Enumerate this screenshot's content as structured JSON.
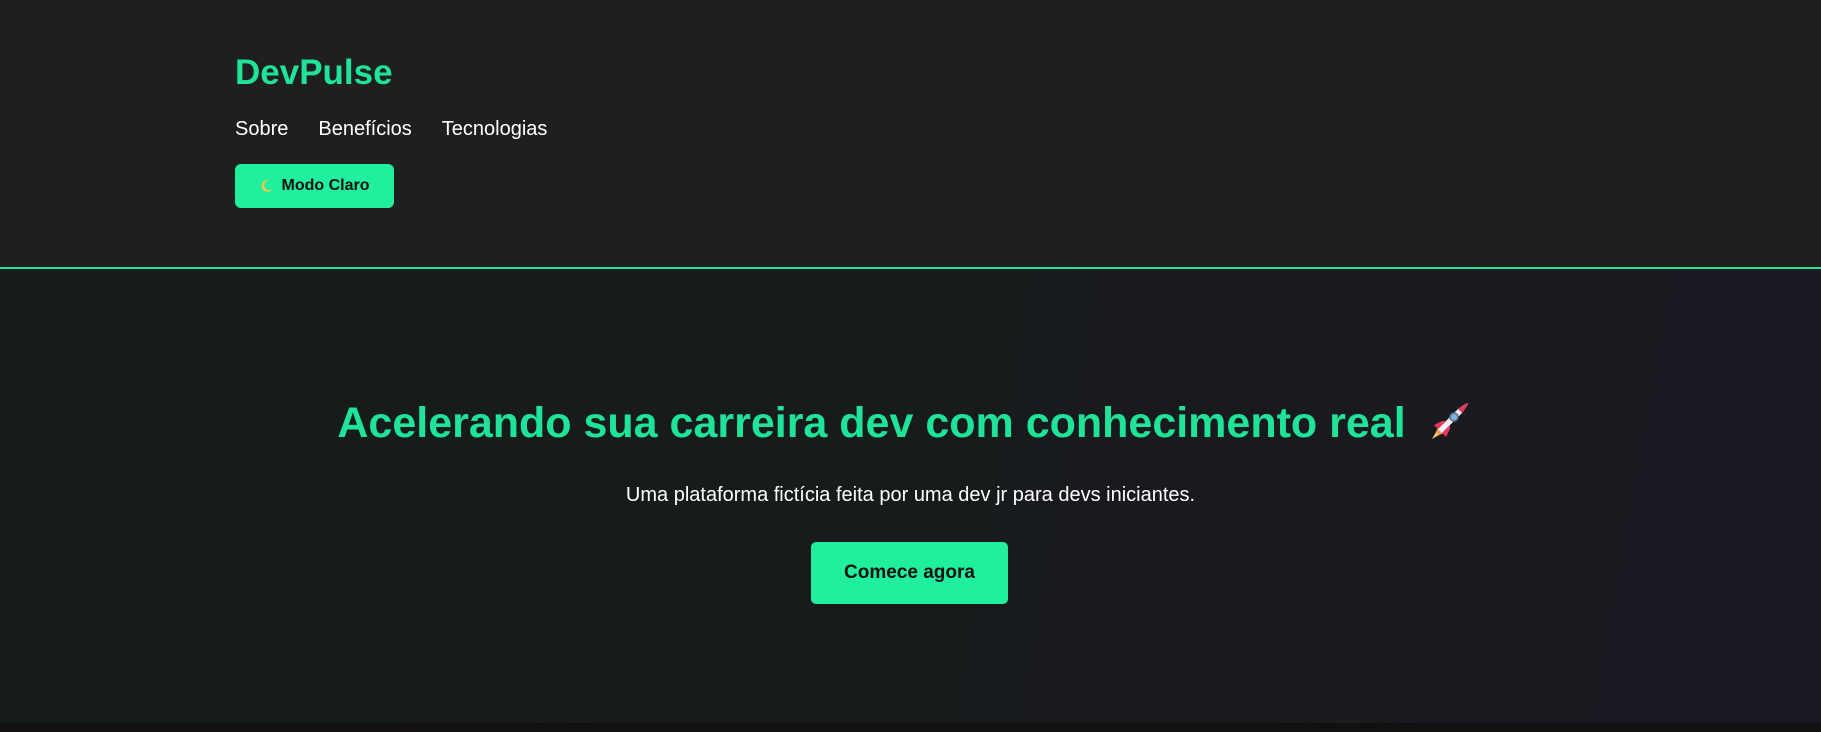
{
  "header": {
    "logo": "DevPulse",
    "nav": [
      {
        "label": "Sobre"
      },
      {
        "label": "Benefícios"
      },
      {
        "label": "Tecnologias"
      }
    ],
    "theme_button": {
      "icon": "moon-icon",
      "label": "Modo Claro"
    }
  },
  "hero": {
    "title": "Acelerando sua carreira dev com conhecimento real",
    "title_icon": "rocket-icon",
    "subtitle": "Uma plataforma fictícia feita por uma dev jr para devs iniciantes.",
    "cta_label": "Comece agora"
  },
  "colors": {
    "accent": "#20e39a",
    "header_bg": "#1f1f1f",
    "button_bg": "#20f09e"
  }
}
